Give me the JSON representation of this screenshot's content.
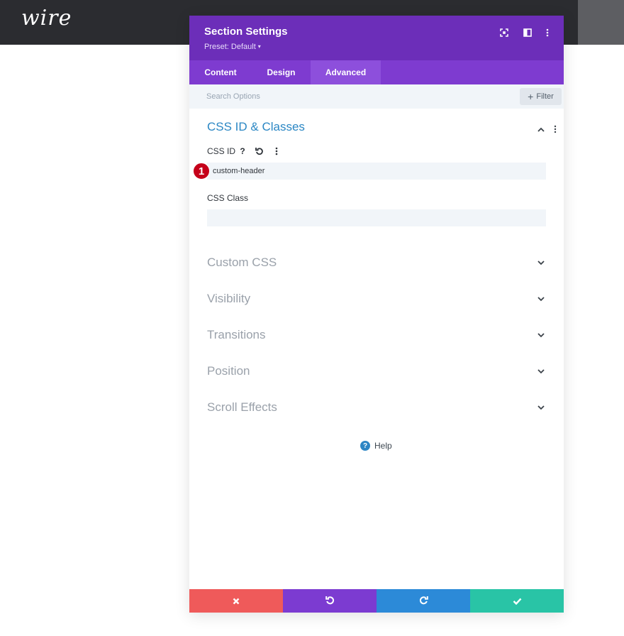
{
  "site": {
    "logo_text": "wire"
  },
  "modal": {
    "title": "Section Settings",
    "preset_label": "Preset: Default",
    "preset_caret": "▾",
    "header_icons": [
      "expand-icon",
      "split-view-icon",
      "more-vertical-icon"
    ],
    "tabs": [
      {
        "label": "Content",
        "active": false
      },
      {
        "label": "Design",
        "active": false
      },
      {
        "label": "Advanced",
        "active": true
      }
    ],
    "search": {
      "placeholder": "Search Options",
      "value": ""
    },
    "filter_label": "Filter",
    "section": {
      "title": "CSS ID & Classes",
      "css_id": {
        "label": "CSS ID",
        "value": "custom-header"
      },
      "css_class": {
        "label": "CSS Class",
        "value": ""
      }
    },
    "badge_number": "1",
    "collapsed_sections": [
      {
        "title": "Custom CSS"
      },
      {
        "title": "Visibility"
      },
      {
        "title": "Transitions"
      },
      {
        "title": "Position"
      },
      {
        "title": "Scroll Effects"
      }
    ],
    "help_label": "Help"
  },
  "footer": {
    "buttons": [
      {
        "name": "cancel",
        "icon": "close-icon",
        "color": "#ef5a5a"
      },
      {
        "name": "undo",
        "icon": "undo-icon",
        "color": "#7c3bd1"
      },
      {
        "name": "redo",
        "icon": "redo-icon",
        "color": "#2c8ad8"
      },
      {
        "name": "save",
        "icon": "check-icon",
        "color": "#29c4a6"
      }
    ]
  },
  "colors": {
    "header_purple": "#6c2eb9",
    "tabs_purple": "#7e3bd0",
    "accent_blue": "#2b87c4",
    "badge_red": "#c5001a"
  }
}
